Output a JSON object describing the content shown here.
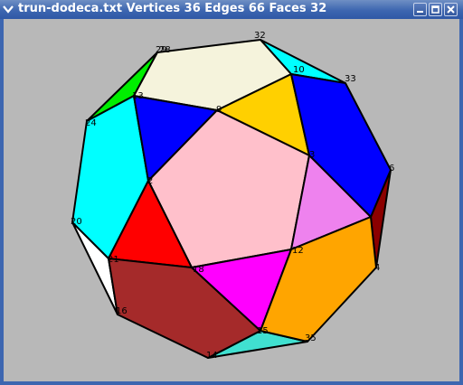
{
  "window": {
    "title": "trun-dodeca.txt  Vertices 36 Edges 66 Faces 32",
    "menu_icon": "chevron-down-icon",
    "buttons": {
      "minimize_icon": "minimize-icon",
      "maximize_icon": "maximize-icon",
      "close_icon": "close-icon"
    }
  },
  "polyhedron": {
    "vertex_labels": [
      "32",
      "29",
      "28",
      "10",
      "33",
      "13",
      "9",
      "24",
      "3",
      "6",
      "2",
      "20",
      "12",
      "21",
      "18",
      "4",
      "16",
      "15",
      "35",
      "14"
    ],
    "face_colors": {
      "cream": "#f5f3dc",
      "cyan": "#00ffff",
      "green": "#00ee00",
      "blue": "#0000ff",
      "gold": "#ffd000",
      "pink": "#ffc0cb",
      "violet": "#ee82ee",
      "red": "#ff0000",
      "dark_red": "#8b0000",
      "brown": "#a52a2a",
      "magenta": "#ff00ff",
      "orange": "#ffa500",
      "turquoise": "#40e0d0",
      "white": "#ffffff",
      "background": "#b8b8b8"
    }
  }
}
